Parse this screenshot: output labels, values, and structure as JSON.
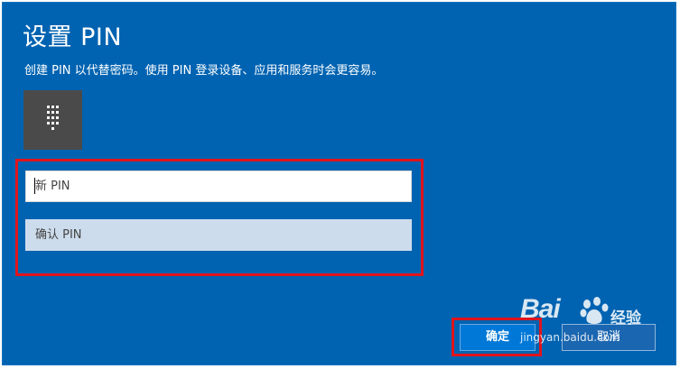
{
  "dialog": {
    "title": "设置 PIN",
    "description": "创建 PIN 以代替密码。使用 PIN 登录设备、应用和服务时会更容易。",
    "icon": "keypad-icon"
  },
  "fields": {
    "new_pin_placeholder": "新 PIN",
    "confirm_pin_placeholder": "确认 PIN"
  },
  "buttons": {
    "ok_label": "确定",
    "cancel_label": "取消"
  },
  "watermark": {
    "brand": "Bai",
    "cn": "经验",
    "url": "jingyan.baidu.com"
  },
  "colors": {
    "background": "#0063b1",
    "highlight": "#e0141c",
    "keypad_tile": "#4a4a4a"
  }
}
